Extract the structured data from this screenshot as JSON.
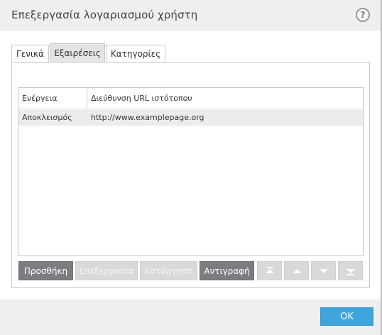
{
  "window": {
    "title": "Επεξεργασία λογαριασμού χρήστη",
    "help_label": "?"
  },
  "tabs": [
    {
      "label": "Γενικά",
      "active": false
    },
    {
      "label": "Εξαιρέσεις",
      "active": true
    },
    {
      "label": "Κατηγορίες",
      "active": false
    }
  ],
  "table": {
    "columns": [
      "Ενέργεια",
      "Διεύθυνση URL ιστότοπου"
    ],
    "rows": [
      {
        "action": "Αποκλεισμός",
        "url": "http://www.examplepage.org"
      }
    ]
  },
  "buttons": {
    "add": "Προσθήκη",
    "edit": "Επεξεργασία",
    "remove": "Κατάργηση",
    "copy": "Αντιγραφή",
    "move_top_icon": "double-up-arrow",
    "move_up_icon": "up-arrow",
    "move_down_icon": "down-arrow",
    "move_bottom_icon": "double-down-arrow"
  },
  "footer": {
    "ok_label": "OK"
  },
  "colors": {
    "accent": "#3fa5dc",
    "button_active": "#7b7d80",
    "button_disabled": "#d9d9d9"
  }
}
